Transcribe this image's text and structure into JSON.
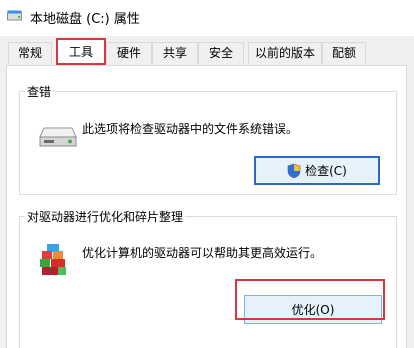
{
  "window": {
    "title": "本地磁盘 (C:) 属性",
    "icon": "drive-icon"
  },
  "tabs": [
    {
      "label": "常规",
      "active": false
    },
    {
      "label": "工具",
      "active": true
    },
    {
      "label": "硬件",
      "active": false
    },
    {
      "label": "共享",
      "active": false
    },
    {
      "label": "安全",
      "active": false
    },
    {
      "label": "以前的版本",
      "active": false
    },
    {
      "label": "配额",
      "active": false
    }
  ],
  "error_check": {
    "group_title": "查错",
    "description": "此选项将检查驱动器中的文件系统错误。",
    "button_label": "检查(C)",
    "icon": "hard-drive-icon",
    "button_icon": "shield-icon"
  },
  "optimize": {
    "group_title": "对驱动器进行优化和碎片整理",
    "description": "优化计算机的驱动器可以帮助其更高效运行。",
    "button_label": "优化(O)",
    "icon": "defrag-icon"
  },
  "colors": {
    "highlight": "#d9363e",
    "focus_border": "#2a69c7"
  }
}
